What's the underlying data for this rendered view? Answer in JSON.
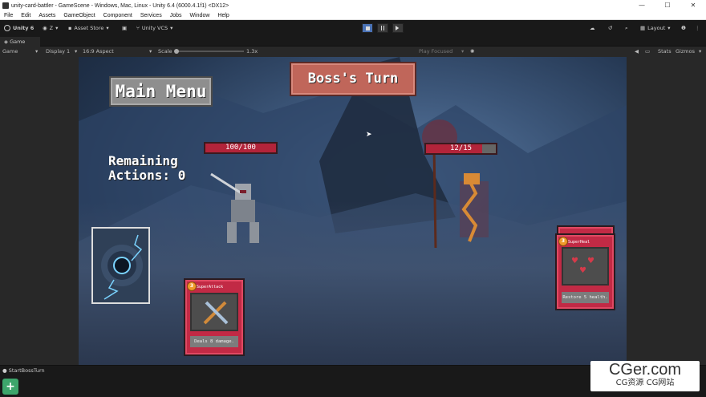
{
  "window": {
    "title": "unity-card-battler - GameScene - Windows, Mac, Linux - Unity 6.4 (6000.4.1f1) <DX12>",
    "controls": [
      "—",
      "☐",
      "✕"
    ]
  },
  "menu": [
    "File",
    "Edit",
    "Assets",
    "GameObject",
    "Component",
    "Services",
    "Jobs",
    "Window",
    "Help"
  ],
  "toolbar": {
    "unity_label": "Unity 6",
    "account_label": "Z",
    "asset_store_label": "Asset Store",
    "vcs_label": "Unity VCS",
    "layout_label": "Layout"
  },
  "tab": {
    "label": "Game"
  },
  "game_toolbar": {
    "mode": "Game",
    "display": "Display 1",
    "aspect": "16:9 Aspect",
    "scale_label": "Scale",
    "scale_value": "1.3x",
    "play_focused": "Play Focused",
    "stats": "Stats",
    "gizmos": "Gizmos"
  },
  "game": {
    "main_menu": "Main Menu",
    "turn_banner": "Boss's Turn",
    "remaining_line1": "Remaining",
    "remaining_line2": "Actions: 0",
    "player_hp": "100/100",
    "boss_hp": "12/15",
    "boss_hp_fraction": 0.8,
    "card_left": {
      "name": "SuperAttack",
      "cost": "3",
      "desc": "Deals 8 damage."
    },
    "card_right": {
      "name": "SuperHeal",
      "cost": "3",
      "desc": "Restore 5 health."
    }
  },
  "status": {
    "text": "StartBossTurn"
  },
  "watermark": {
    "main": "CGer.com",
    "sub": "CG资源 CG网站"
  },
  "colors": {
    "play_active": "#4a72b5",
    "card_red": "#c22a45",
    "hp_red": "#b3243a",
    "banner": "#c0665a"
  }
}
